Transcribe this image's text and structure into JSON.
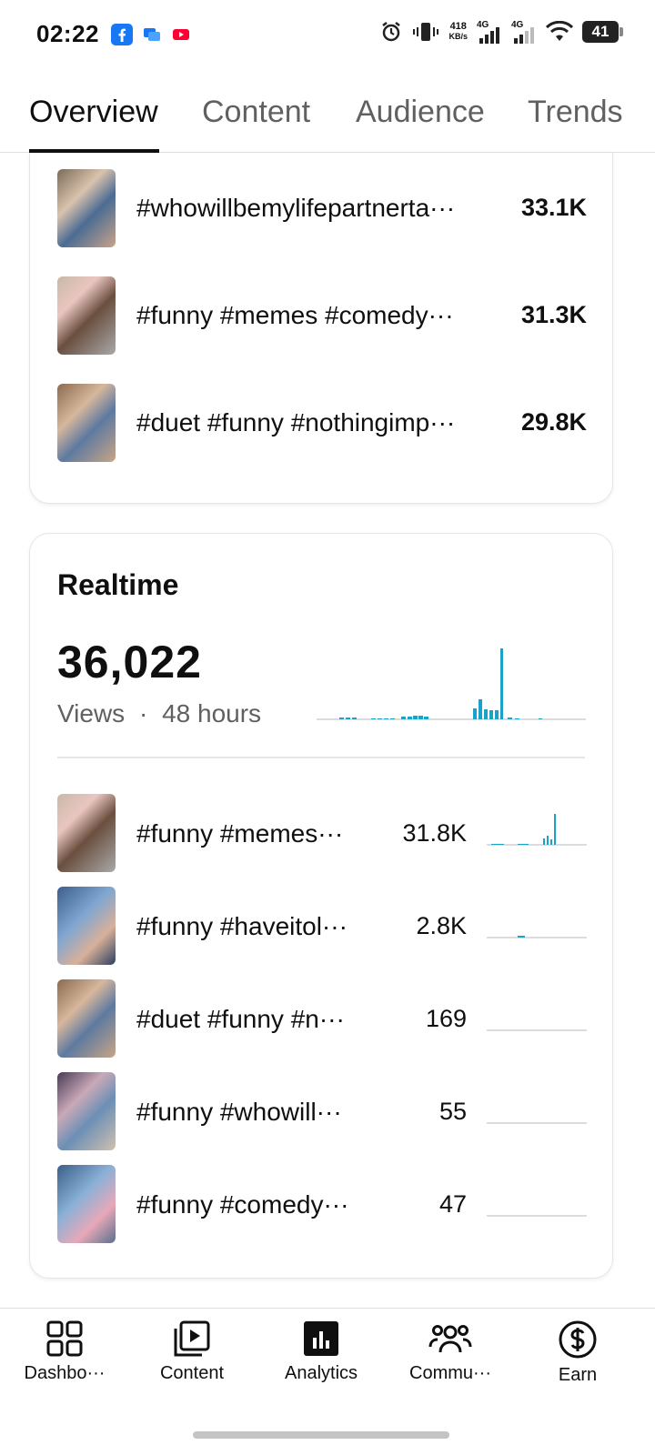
{
  "status_bar": {
    "time": "02:22",
    "net_speed_value": "418",
    "net_speed_unit": "KB/s",
    "signal1": "4G",
    "signal2": "4G",
    "battery": "41"
  },
  "tabs": [
    {
      "label": "Overview",
      "active": true
    },
    {
      "label": "Content",
      "active": false
    },
    {
      "label": "Audience",
      "active": false
    },
    {
      "label": "Trends",
      "active": false
    }
  ],
  "top_content": {
    "rows": [
      {
        "title": "#whowillbemylifepartnerta···",
        "value": "33.1K"
      },
      {
        "title": "#funny #memes #comedy···",
        "value": "31.3K"
      },
      {
        "title": "#duet #funny #nothingimp···",
        "value": "29.8K"
      }
    ]
  },
  "realtime": {
    "title": "Realtime",
    "views": "36,022",
    "views_label": "Views",
    "separator": "·",
    "period": "48 hours",
    "rows": [
      {
        "title": "#funny #memes···",
        "value": "31.8K"
      },
      {
        "title": "#funny #haveitol···",
        "value": "2.8K"
      },
      {
        "title": "#duet #funny #n···",
        "value": "169"
      },
      {
        "title": "#funny #whowill···",
        "value": "55"
      },
      {
        "title": "#funny #comedy···",
        "value": "47"
      }
    ]
  },
  "bottom_nav": [
    {
      "label": "Dashbo···",
      "icon": "dashboard-icon"
    },
    {
      "label": "Content",
      "icon": "content-icon"
    },
    {
      "label": "Analytics",
      "icon": "analytics-icon",
      "active": true
    },
    {
      "label": "Commu···",
      "icon": "community-icon"
    },
    {
      "label": "Earn",
      "icon": "earn-icon"
    }
  ],
  "colors": {
    "bar_accent": "#1aa3c7",
    "text_primary": "#0f0f0f",
    "text_secondary": "#606060"
  }
}
